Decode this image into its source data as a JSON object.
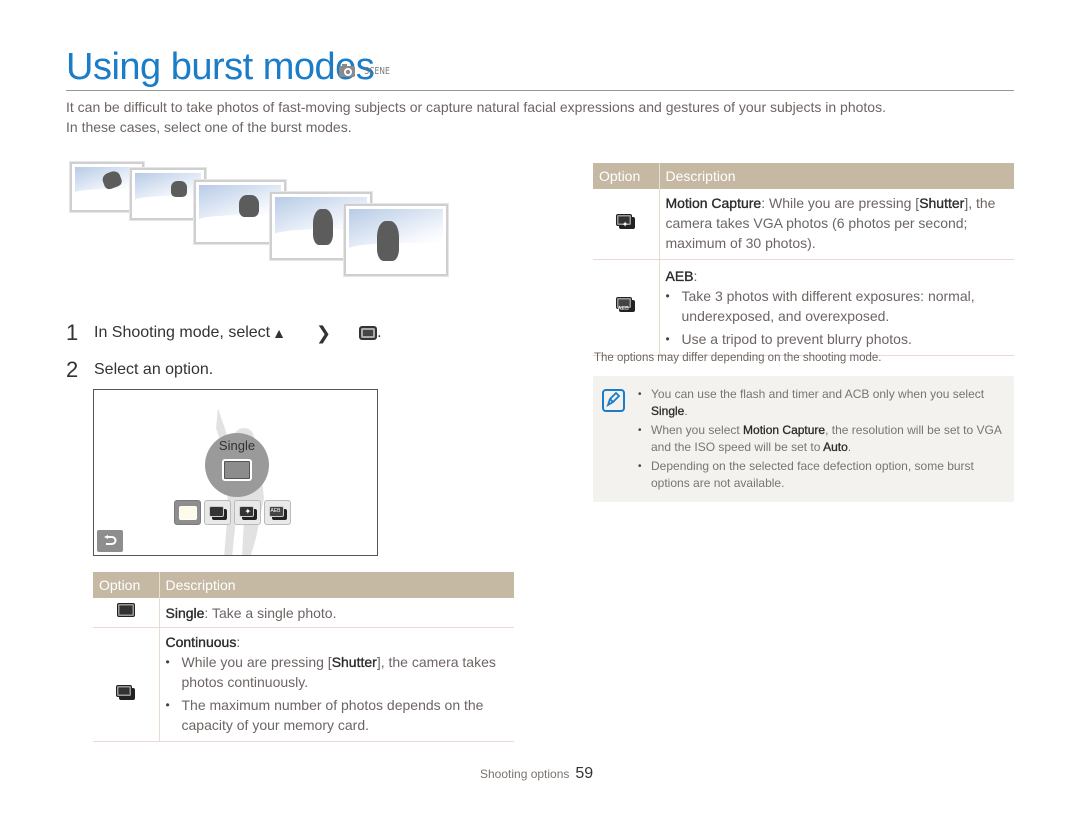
{
  "header": {
    "title": "Using burst modes",
    "mode_icons": [
      "smart-scene-icon",
      "scene-icon"
    ],
    "scene_label": "SCENE"
  },
  "intro": {
    "line1": "It can be difficult to take photos of fast-moving subjects or capture natural facial expressions and gestures of your subjects in photos.",
    "line2": "In these cases, select one of the burst modes."
  },
  "illustration": {
    "name": "snowboarder-burst-sequence",
    "frames": 5
  },
  "steps": [
    {
      "num": "1",
      "text": "In Shooting mode, select",
      "icons": [
        "up-triangle-icon",
        "chevron-right-icon",
        "single-shot-icon"
      ],
      "suffix": "."
    },
    {
      "num": "2",
      "text": "Select an option."
    }
  ],
  "lcd": {
    "selected_label": "Single",
    "options": [
      "single-icon",
      "continuous-icon",
      "motion-capture-icon",
      "aeb-icon"
    ],
    "active_index": 0,
    "back_icon": "back-icon"
  },
  "table_left": {
    "headers": {
      "option": "Option",
      "description": "Description"
    },
    "rows": [
      {
        "icon": "single-icon",
        "title": "Single",
        "sep": ": ",
        "text": "Take a single photo."
      },
      {
        "icon": "continuous-icon",
        "title": "Continuous",
        "sep": ":",
        "bullets": [
          {
            "pre": "While you are pressing [",
            "bold": "Shutter",
            "post": "], the camera takes photos continuously."
          },
          {
            "pre": "The maximum number of photos depends on the capacity of your memory card."
          }
        ]
      }
    ]
  },
  "table_right": {
    "headers": {
      "option": "Option",
      "description": "Description"
    },
    "rows": [
      {
        "icon": "motion-capture-icon",
        "title": "Motion Capture",
        "text_pre": ": While you are pressing [",
        "bold": "Shutter",
        "text_post": "], the camera takes VGA photos (6 photos per second; maximum of 30 photos)."
      },
      {
        "icon": "aeb-icon",
        "title": "AEB",
        "sep": ":",
        "bullets": [
          {
            "pre": "Take 3 photos with different exposures: normal, underexposed, and overexposed."
          },
          {
            "pre": "Use a tripod to prevent blurry photos."
          }
        ]
      }
    ]
  },
  "options_note": "The options may differ depending on the shooting mode.",
  "notes": {
    "icon": "note-pencil-icon",
    "items": [
      {
        "pre": "You can use the flash and timer and ACB only when you select ",
        "bold": "Single",
        "post": "."
      },
      {
        "pre": "When you select ",
        "bold": "Motion Capture",
        "mid": ", the resolution will be set to VGA and the ISO speed will be set to ",
        "bold2": "Auto",
        "post": "."
      },
      {
        "pre": "Depending on the selected face defection option, some burst options are not available."
      }
    ]
  },
  "footer": {
    "section": "Shooting options",
    "page": "59"
  },
  "colors": {
    "title": "#1b7cc7",
    "table_header": "#c6b9a3",
    "note_bg": "#f3f2ef"
  }
}
